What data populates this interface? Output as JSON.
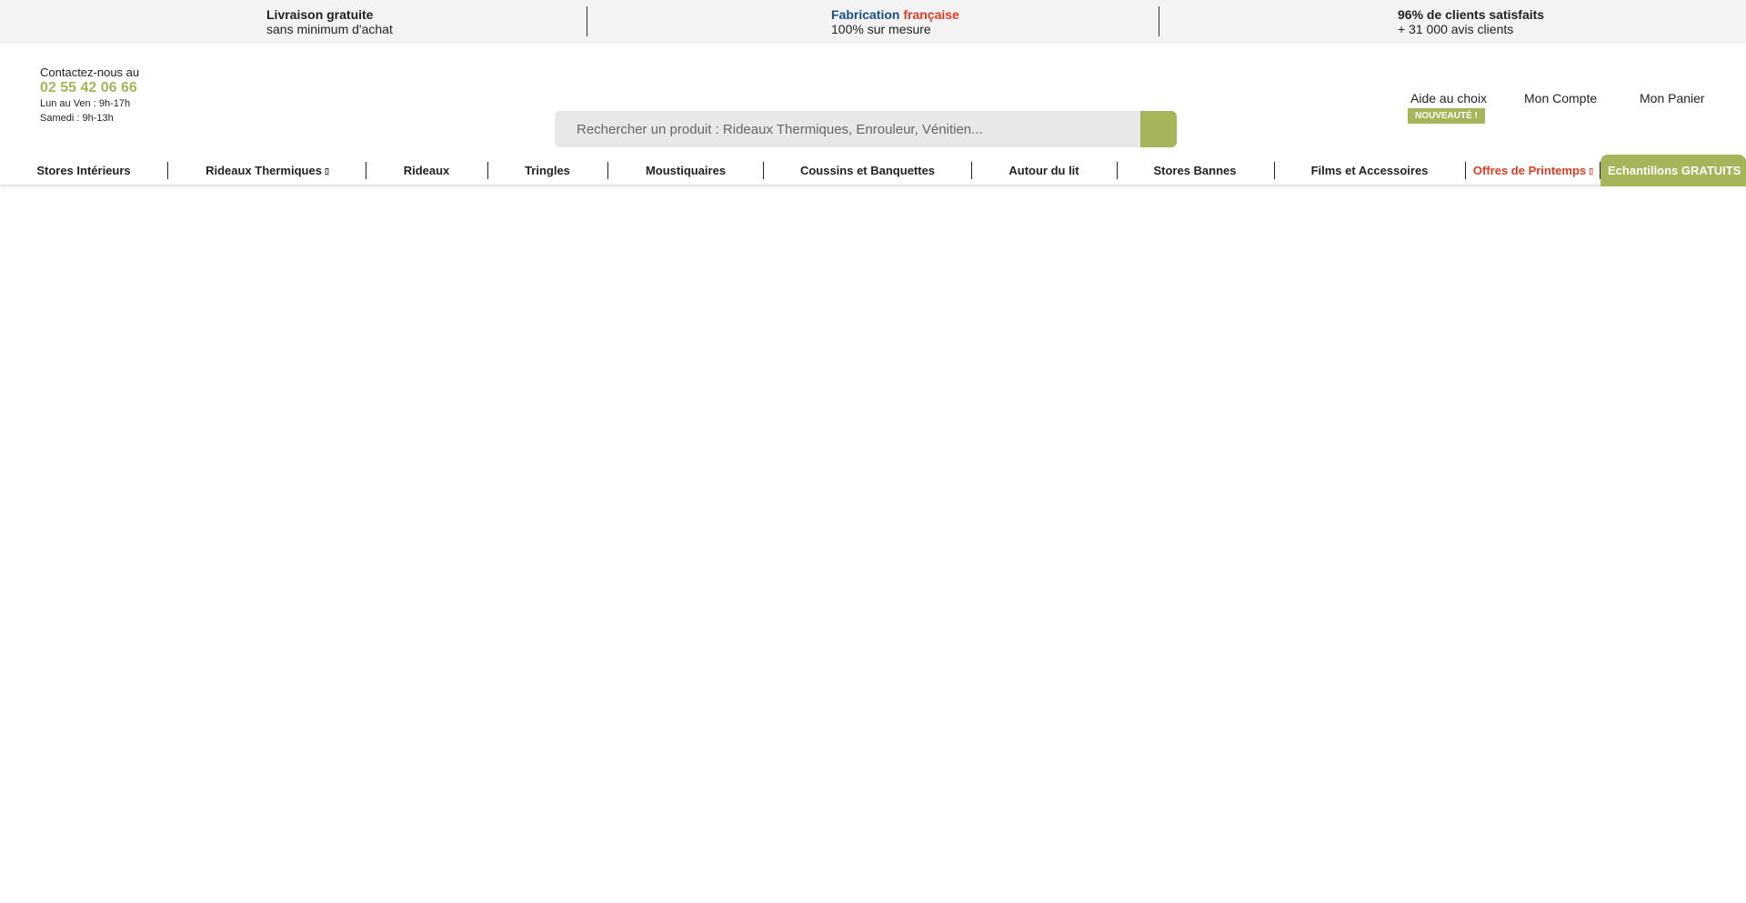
{
  "topbar": {
    "delivery": {
      "title": "Livraison gratuite",
      "subtitle": "sans minimum d'achat"
    },
    "fabrication": {
      "title_part1": "Fabrication",
      "title_part2": "française",
      "subtitle": "100% sur mesure"
    },
    "satisfaction": {
      "title": "96% de clients satisfaits",
      "subtitle": "+ 31 000 avis clients"
    }
  },
  "contact": {
    "label": "Contactez-nous au",
    "phone": "02 55 42 06 66",
    "hours_weekday": "Lun au Ven : 9h-17h",
    "hours_saturday": "Samedi : 9h-13h"
  },
  "search": {
    "placeholder": "Rechercher un produit : Rideaux Thermiques, Enrouleur, Vénitien...",
    "value": "",
    "button_icon": "search-icon"
  },
  "account": {
    "help": "Aide au choix",
    "help_badge": "NOUVEAUTÉ !",
    "account": "Mon Compte",
    "cart": "Mon Panier"
  },
  "nav": {
    "items": [
      {
        "label": "Stores Intérieurs"
      },
      {
        "label": "Rideaux Thermiques",
        "has_icon": true
      },
      {
        "label": "Rideaux"
      },
      {
        "label": "Tringles"
      },
      {
        "label": "Moustiquaires"
      },
      {
        "label": "Coussins et Banquettes"
      },
      {
        "label": "Autour du lit"
      },
      {
        "label": "Stores Bannes"
      },
      {
        "label": "Films et Accessoires"
      },
      {
        "label": "Offres de Printemps",
        "has_icon": true
      },
      {
        "label": "Echantillons GRATUITS"
      }
    ]
  },
  "colors": {
    "accent_green": "#a5b55a",
    "accent_red": "#e03b24",
    "accent_blue": "#1b4f8a",
    "topbar_bg": "#f3f3f3"
  }
}
